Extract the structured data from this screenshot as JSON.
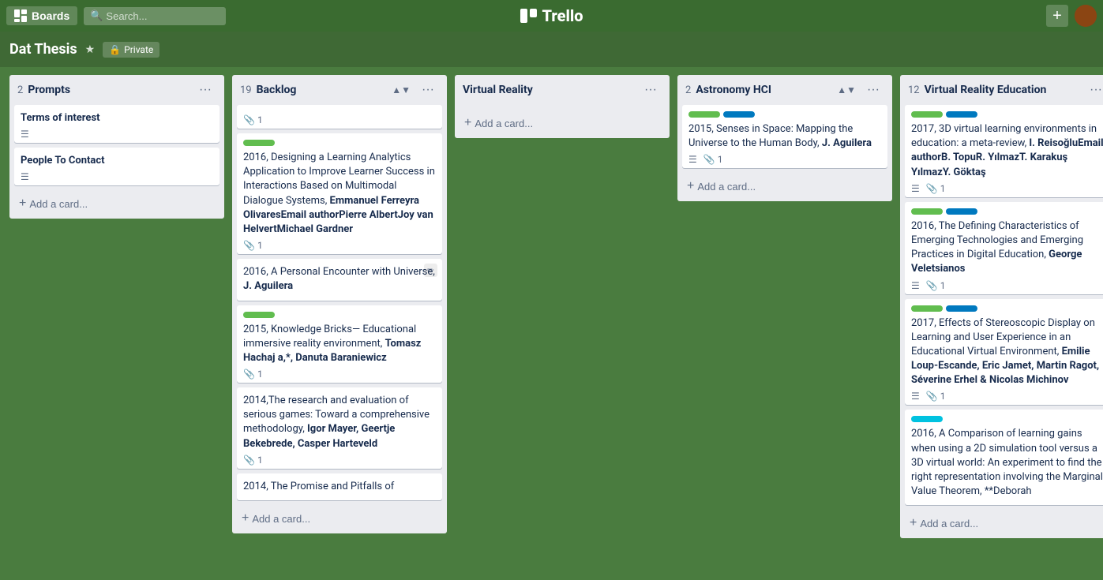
{
  "topnav": {
    "boards_label": "Boards",
    "search_placeholder": "Search...",
    "logo_text": "Trello",
    "add_button_label": "+"
  },
  "board": {
    "title": "Dat Thesis",
    "privacy": "Private",
    "columns": [
      {
        "id": "prompts",
        "count": 2,
        "title": "Prompts",
        "cards": [
          {
            "id": "p1",
            "text": "**Terms of interest **",
            "labels": [],
            "attachments": 0,
            "has_description": true
          },
          {
            "id": "p2",
            "text": "**People To Contact**",
            "labels": [],
            "attachments": 0,
            "has_description": true
          }
        ],
        "add_label": "Add a card..."
      },
      {
        "id": "backlog",
        "count": 19,
        "title": "Backlog",
        "sortable": true,
        "cards": [
          {
            "id": "b0",
            "text": "",
            "labels": [],
            "attachments": 1,
            "has_description": false,
            "empty_label": true
          },
          {
            "id": "b1",
            "text": "2016, Designing a Learning Analytics Application to Improve Learner Success in Interactions Based on Multimodal Dialogue Systems, **Emmanuel Ferreyra OlivaresEmail authorPierre AlbertJoy van HelvertMichael Gardner**",
            "labels": [
              "green"
            ],
            "attachments": 1,
            "has_description": false
          },
          {
            "id": "b2",
            "text": "2016, A Personal Encounter with Universe, **J. Aguilera**",
            "labels": [],
            "attachments": 0,
            "has_description": false,
            "hover": true
          },
          {
            "id": "b3",
            "text": "2015, Knowledge Bricks— Educational immersive reality environment, **Tomasz Hachaj a,*, Danuta Baraniewicz**",
            "labels": [
              "green"
            ],
            "attachments": 1,
            "has_description": false
          },
          {
            "id": "b4",
            "text": "2014,The research and evaluation of serious games: Toward a comprehensive methodology, **Igor Mayer, Geertje Bekebrede, Casper Harteveld**",
            "labels": [],
            "attachments": 1,
            "has_description": false
          },
          {
            "id": "b5",
            "text": "2014, The Promise and Pitfalls of",
            "labels": [],
            "attachments": 0,
            "has_description": false
          }
        ],
        "add_label": "Add a card..."
      },
      {
        "id": "virtual-reality",
        "count": 0,
        "title": "Virtual Reality",
        "cards": [],
        "add_label": "Add a card..."
      },
      {
        "id": "astronomy-hci",
        "count": 2,
        "title": "Astronomy HCI",
        "sortable": true,
        "cards": [
          {
            "id": "a1",
            "text": "2015, Senses in Space: Mapping the Universe to the Human Body, **J. Aguilera**",
            "labels": [
              "green",
              "blue"
            ],
            "attachments": 1,
            "has_description": true
          }
        ],
        "add_label": "Add a card..."
      },
      {
        "id": "vr-education",
        "count": 12,
        "title": "Virtual Reality Education",
        "cards": [
          {
            "id": "vr1",
            "text": "2017, 3D virtual learning environments in education: a meta-review, **I. ReisoğluEmail authorB. TopuR. YılmazT. Karakuş YılmazY. Göktaş**",
            "labels": [
              "green",
              "blue"
            ],
            "attachments": 1,
            "has_description": true
          },
          {
            "id": "vr2",
            "text": "2016, The Defining Characteristics of Emerging Technologies and Emerging Practices in Digital Education, **George Veletsianos**",
            "labels": [
              "green",
              "blue"
            ],
            "attachments": 1,
            "has_description": true
          },
          {
            "id": "vr3",
            "text": "2017, Effects of Stereoscopic Display on Learning and User Experience in an Educational Virtual Environment, **Emilie Loup-Escande, Eric Jamet, Martin Ragot, Séverine Erhel & Nicolas Michinov**",
            "labels": [
              "green",
              "blue"
            ],
            "attachments": 1,
            "has_description": true
          },
          {
            "id": "vr4",
            "text": "2016, A Comparison of learning gains when using a 2D simulation tool versus a 3D virtual world: An experiment to find the right representation involving the Marginal Value Theorem, **Deborah",
            "labels": [
              "teal"
            ],
            "attachments": 0,
            "has_description": false
          }
        ],
        "add_label": "Add a card..."
      }
    ]
  }
}
